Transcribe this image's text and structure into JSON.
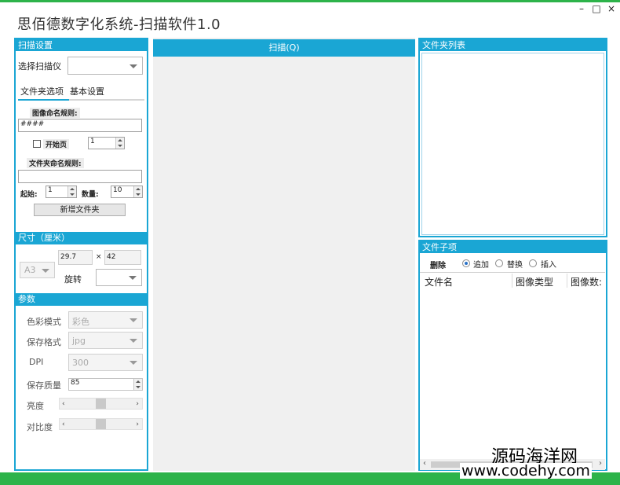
{
  "app": {
    "title": "思佰德数字化系统-扫描软件1.0"
  },
  "window_controls": {
    "minimize": "–",
    "maximize": "□",
    "close": "×"
  },
  "scan_settings": {
    "header": "扫描设置",
    "scanner_label": "选择扫描仪",
    "scanner_value": "",
    "tabs": [
      {
        "label": "文件夹选项",
        "active": true
      },
      {
        "label": "基本设置",
        "active": false
      }
    ],
    "image_naming_label": "图像命名规则:",
    "image_naming_value": "####",
    "start_page_label": "开始页",
    "start_page_checked": false,
    "start_page_value": "1",
    "folder_naming_label": "文件夹命名规则:",
    "folder_naming_value": "",
    "start_label": "起始:",
    "start_value": "1",
    "count_label": "数量:",
    "count_value": "10",
    "new_folder_button": "新增文件夹"
  },
  "size": {
    "header": "尺寸（厘米）",
    "paper": "A3",
    "width": "29.7",
    "times": "×",
    "height": "42",
    "rotate_label": "旋转",
    "rotate_value": ""
  },
  "params": {
    "header": "参数",
    "color_mode_label": "色彩模式",
    "color_mode_value": "彩色",
    "save_format_label": "保存格式",
    "save_format_value": "jpg",
    "dpi_label": "DPI",
    "dpi_value": "300",
    "quality_label": "保存质量",
    "quality_value": "85",
    "brightness_label": "亮度",
    "brightness_level": 0.5,
    "contrast_label": "对比度",
    "contrast_level": 0.5,
    "arrow_left": "‹",
    "arrow_right": "›"
  },
  "scan": {
    "button": "扫描(Q)"
  },
  "folder_list": {
    "header": "文件夹列表"
  },
  "file_items": {
    "header": "文件子项",
    "delete_button": "删除",
    "modes": [
      {
        "label": "追加",
        "selected": true
      },
      {
        "label": "替换",
        "selected": false
      },
      {
        "label": "插入",
        "selected": false
      }
    ],
    "columns": [
      "文件名",
      "图像类型",
      "图像数:"
    ],
    "scroll_left": "‹",
    "scroll_right": "›"
  },
  "watermark": {
    "line1": "源码海洋网",
    "line2": "www.codehy.com"
  },
  "colors": {
    "accent": "#1aa6d4",
    "brand_green": "#2db34a"
  }
}
